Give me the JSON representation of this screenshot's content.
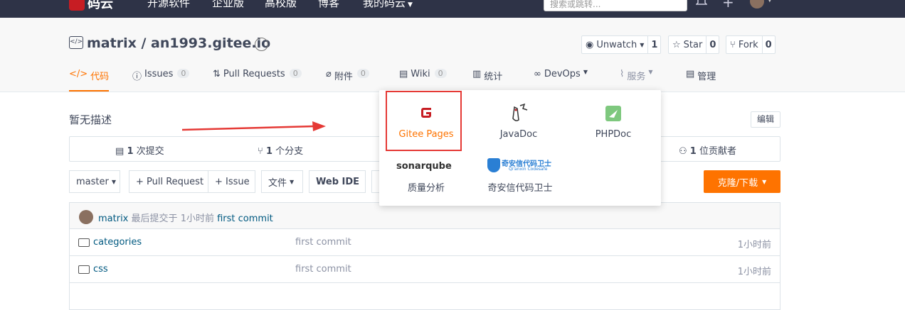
{
  "topnav": {
    "logo_text": "码云",
    "links": [
      "开源软件",
      "企业版",
      "高校版",
      "博客",
      "我的码云"
    ],
    "search_placeholder": "搜索或跳转..."
  },
  "repo": {
    "title": "matrix / an1993.gitee.io",
    "watch": {
      "label": "Unwatch",
      "count": "1"
    },
    "star": {
      "label": "Star",
      "count": "0"
    },
    "fork": {
      "label": "Fork",
      "count": "0"
    }
  },
  "tabs": [
    {
      "label": "代码"
    },
    {
      "label": "Issues",
      "count": "0"
    },
    {
      "label": "Pull Requests",
      "count": "0"
    },
    {
      "label": "附件",
      "count": "0"
    },
    {
      "label": "Wiki",
      "count": "0"
    },
    {
      "label": "统计"
    },
    {
      "label": "DevOps"
    },
    {
      "label": "服务"
    },
    {
      "label": "管理"
    }
  ],
  "description": "暂无描述",
  "edit_label": "编辑",
  "stats": {
    "commits": {
      "num": "1",
      "unit": "次提交"
    },
    "branches": {
      "num": "1",
      "unit": "个分支"
    },
    "contributors": {
      "num": "1",
      "unit": "位贡献者"
    }
  },
  "toolbar": {
    "branch": "master",
    "pull_request": "+ Pull Request",
    "issue": "+ Issue",
    "files": "文件",
    "web_ide": "Web IDE",
    "clone": "克隆/下载"
  },
  "last_commit": {
    "author": "matrix",
    "text": "最后提交于",
    "time": "1小时前",
    "message": "first commit"
  },
  "files": [
    {
      "name": "categories",
      "message": "first commit",
      "time": "1小时前"
    },
    {
      "name": "css",
      "message": "first commit",
      "time": "1小时前"
    }
  ],
  "services": {
    "gitee_pages": "Gitee Pages",
    "javadoc": "JavaDoc",
    "phpdoc": "PHPDoc",
    "sonarqube_logo": "sonarqube",
    "sonarqube_label": "质量分析",
    "qianxin_logo": "奇安信代码卫士",
    "qianxin_sub": "Qi'anxin Codesafe",
    "qianxin_label": "奇安信代码卫士"
  },
  "colors": {
    "accent": "#fe7300",
    "brand": "#c71d23",
    "topnav": "#2e3347",
    "highlight": "#e53935"
  }
}
